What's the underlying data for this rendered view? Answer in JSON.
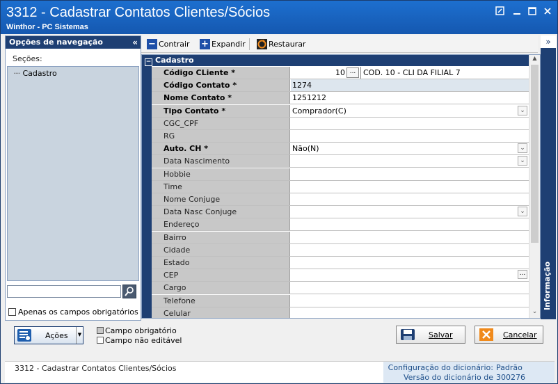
{
  "window": {
    "title": "3312 - Cadastrar Contatos Clientes/Sócios",
    "subtitle": "Winthor - PC Sistemas"
  },
  "nav": {
    "header": "Opções de navegação",
    "sections_label": "Seções:",
    "tree_items": [
      "Cadastro"
    ],
    "search_value": "",
    "only_required_label": "Apenas os campos obrigatórios"
  },
  "toolbar": {
    "collapse_label": "Contrair",
    "expand_label": "Expandir",
    "restore_label": "Restaurar"
  },
  "form": {
    "group_title": "Cadastro",
    "fields": [
      {
        "label": "Código CLiente *",
        "value": "",
        "required": true,
        "kind": "code",
        "code": "10",
        "code_desc": "COD. 10 - CLI DA FILIAL 7"
      },
      {
        "label": "Código Contato *",
        "value": "1274",
        "required": true,
        "kind": "readonly"
      },
      {
        "label": "Nome Contato *",
        "value": "1251212",
        "required": true,
        "kind": "text"
      },
      {
        "label": "Tipo Contato *",
        "value": "Comprador(C)",
        "required": true,
        "kind": "dropdown"
      },
      {
        "label": "CGC_CPF",
        "value": "",
        "required": false,
        "kind": "text"
      },
      {
        "label": "RG",
        "value": "",
        "required": false,
        "kind": "text"
      },
      {
        "label": "Auto. CH *",
        "value": "Não(N)",
        "required": true,
        "kind": "dropdown"
      },
      {
        "label": "Data Nascimento",
        "value": "",
        "required": false,
        "kind": "dropdown"
      },
      {
        "label": "Hobbie",
        "value": "",
        "required": false,
        "kind": "text"
      },
      {
        "label": "Time",
        "value": "",
        "required": false,
        "kind": "text"
      },
      {
        "label": "Nome Conjuge",
        "value": "",
        "required": false,
        "kind": "text"
      },
      {
        "label": "Data Nasc Conjuge",
        "value": "",
        "required": false,
        "kind": "dropdown"
      },
      {
        "label": "Endereço",
        "value": "",
        "required": false,
        "kind": "text"
      },
      {
        "label": "Bairro",
        "value": "",
        "required": false,
        "kind": "text"
      },
      {
        "label": "Cidade",
        "value": "",
        "required": false,
        "kind": "text"
      },
      {
        "label": "Estado",
        "value": "",
        "required": false,
        "kind": "text"
      },
      {
        "label": "CEP",
        "value": "",
        "required": false,
        "kind": "ellipsis"
      },
      {
        "label": "Cargo",
        "value": "",
        "required": false,
        "kind": "text"
      },
      {
        "label": "Telefone",
        "value": "",
        "required": false,
        "kind": "text"
      },
      {
        "label": "Celular",
        "value": "",
        "required": false,
        "kind": "text"
      }
    ]
  },
  "info_panel": {
    "label": "Informação"
  },
  "bottom": {
    "actions_label": "Ações",
    "legend_required": "Campo obrigatório",
    "legend_not_editable": "Campo não editável",
    "save_label": "Salvar",
    "cancel_label": "Cancelar"
  },
  "status": {
    "left": "3312 - Cadastrar Contatos Clientes/Sócios",
    "dict_config_label": "Configuração do dicionário:",
    "dict_config_value": "Padrão",
    "dict_version_label": "Versão do dicionário de dados:",
    "dict_version_value": "300276"
  },
  "colors": {
    "title_bar": "#1558b0",
    "panel_header": "#1e3f73",
    "label_bg": "#c8c8c8",
    "readonly_bg": "#dde6ee",
    "cancel_icon": "#f08a1c"
  }
}
